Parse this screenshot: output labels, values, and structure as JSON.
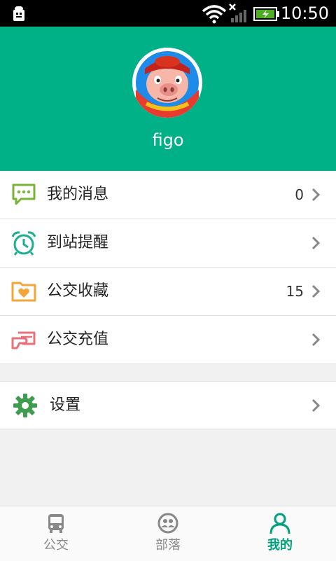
{
  "status_bar": {
    "time": "10:50"
  },
  "profile": {
    "username": "figo"
  },
  "menu": [
    {
      "label": "我的消息",
      "count": "0"
    },
    {
      "label": "到站提醒",
      "count": ""
    },
    {
      "label": "公交收藏",
      "count": "15"
    },
    {
      "label": "公交充值",
      "count": ""
    }
  ],
  "settings": {
    "label": "设置"
  },
  "tabs": [
    {
      "label": "公交"
    },
    {
      "label": "部落"
    },
    {
      "label": "我的"
    }
  ],
  "colors": {
    "brand": "#00b187",
    "active_tab": "#00a07d"
  },
  "icons": [
    "android-debug-icon",
    "wifi-icon",
    "signal-icon",
    "battery-icon",
    "message-icon",
    "alarm-icon",
    "favorites-folder-icon",
    "card-recharge-icon",
    "gear-icon",
    "chevron-right-icon",
    "bus-icon",
    "group-icon",
    "person-icon"
  ]
}
